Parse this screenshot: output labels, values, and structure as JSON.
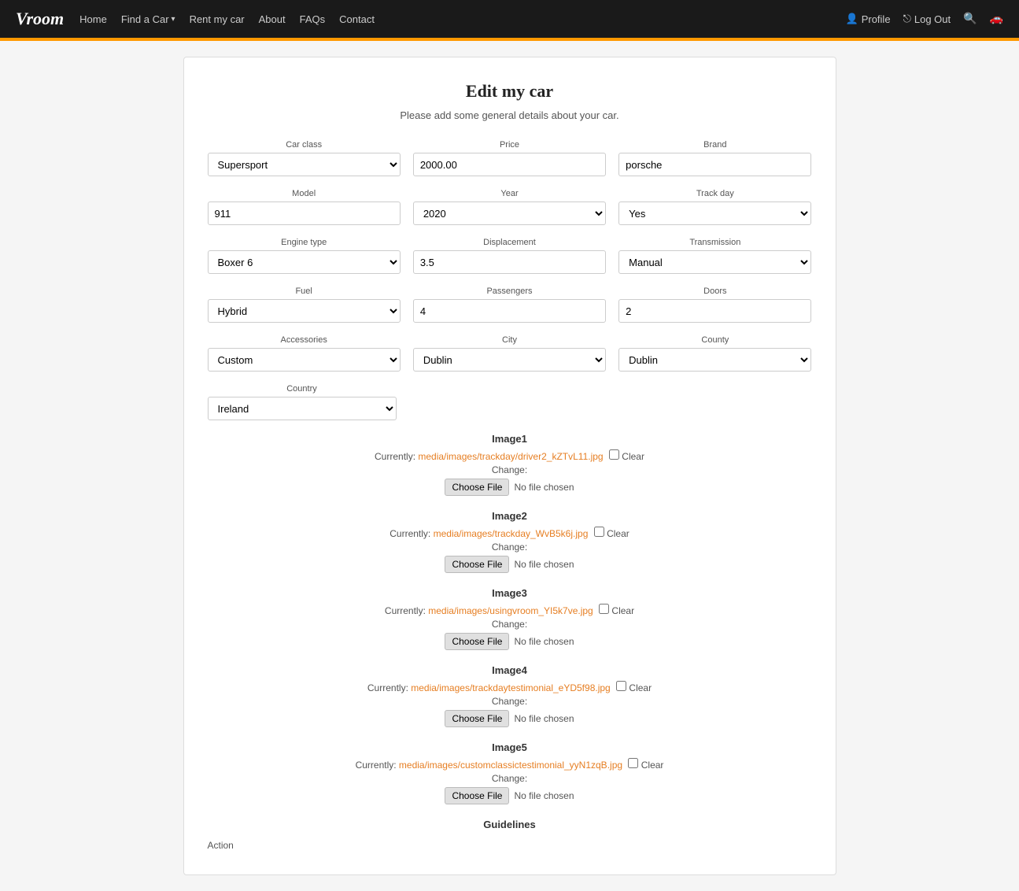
{
  "navbar": {
    "brand": "Vroom",
    "links": [
      {
        "label": "Home",
        "name": "home"
      },
      {
        "label": "Find a Car",
        "name": "find-a-car",
        "dropdown": true
      },
      {
        "label": "Rent my car",
        "name": "rent-my-car"
      },
      {
        "label": "About",
        "name": "about"
      },
      {
        "label": "FAQs",
        "name": "faqs"
      },
      {
        "label": "Contact",
        "name": "contact"
      }
    ],
    "profile_label": "Profile",
    "logout_label": "Log Out"
  },
  "form": {
    "title": "Edit my car",
    "subtitle": "Please add some general details about your car.",
    "fields": {
      "car_class_label": "Car class",
      "car_class_value": "Supersport",
      "price_label": "Price",
      "price_value": "2000.00",
      "brand_label": "Brand",
      "brand_value": "porsche",
      "model_label": "Model",
      "model_value": "911",
      "year_label": "Year",
      "year_value": "2020",
      "track_day_label": "Track day",
      "track_day_value": "Yes",
      "engine_type_label": "Engine type",
      "engine_type_value": "Boxer 6",
      "displacement_label": "Displacement",
      "displacement_value": "3.5",
      "transmission_label": "Transmission",
      "transmission_value": "Manual",
      "fuel_label": "Fuel",
      "fuel_value": "Hybrid",
      "passengers_label": "Passengers",
      "passengers_value": "4",
      "doors_label": "Doors",
      "doors_value": "2",
      "accessories_label": "Accessories",
      "accessories_value": "Custom",
      "city_label": "City",
      "city_value": "Dublin",
      "county_label": "County",
      "county_value": "Dublin",
      "country_label": "Country",
      "country_value": "Ireland"
    },
    "images": [
      {
        "name": "Image1",
        "currently_label": "Currently:",
        "file_link": "media/images/trackday/driver2_kZTvL11.jpg",
        "clear_label": "Clear",
        "change_label": "Change:",
        "no_file": "No file chosen"
      },
      {
        "name": "Image2",
        "currently_label": "Currently:",
        "file_link": "media/images/trackday_WvB5k6j.jpg",
        "clear_label": "Clear",
        "change_label": "Change:",
        "no_file": "No file chosen"
      },
      {
        "name": "Image3",
        "currently_label": "Currently:",
        "file_link": "media/images/usingvroom_YI5k7ve.jpg",
        "clear_label": "Clear",
        "change_label": "Change:",
        "no_file": "No file chosen"
      },
      {
        "name": "Image4",
        "currently_label": "Currently:",
        "file_link": "media/images/trackdaytestimonial_eYD5f98.jpg",
        "clear_label": "Clear",
        "change_label": "Change:",
        "no_file": "No file chosen"
      },
      {
        "name": "Image5",
        "currently_label": "Currently:",
        "file_link": "media/images/customclassictestimonial_yyN1zqB.jpg",
        "clear_label": "Clear",
        "change_label": "Change:",
        "no_file": "No file chosen"
      }
    ],
    "guidelines_label": "Guidelines",
    "action_label": "Action"
  }
}
